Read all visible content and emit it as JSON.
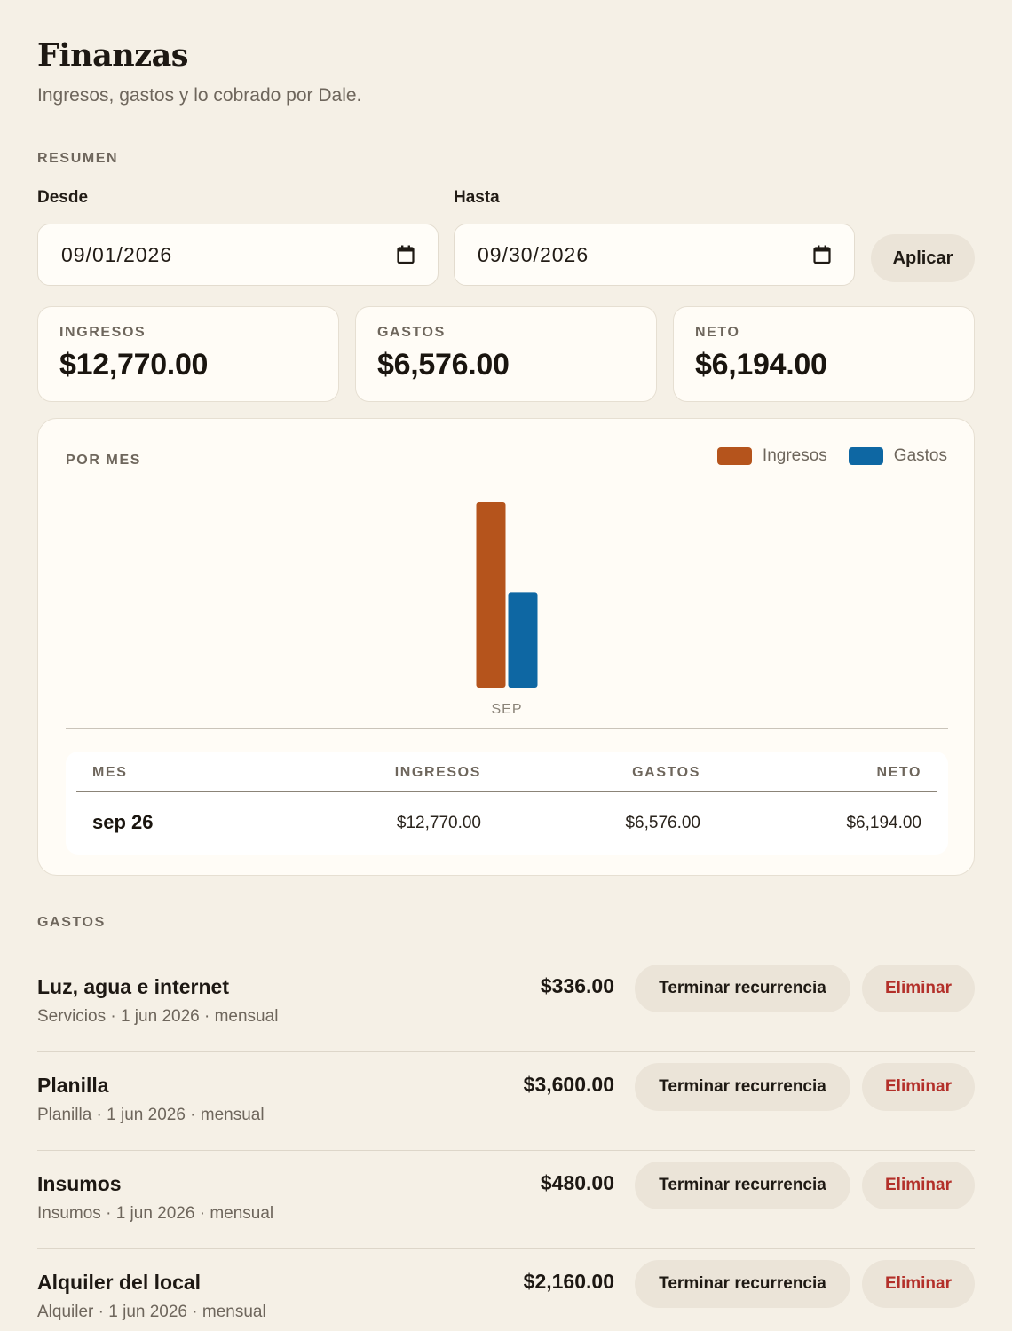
{
  "header": {
    "title": "Finanzas",
    "subtitle": "Ingresos, gastos y lo cobrado por Dale."
  },
  "summary": {
    "section_label": "RESUMEN",
    "from_label": "Desde",
    "from_value": "09/01/2026",
    "to_label": "Hasta",
    "to_value": "09/30/2026",
    "apply_label": "Aplicar",
    "cards": [
      {
        "label": "INGRESOS",
        "value": "$12,770.00"
      },
      {
        "label": "GASTOS",
        "value": "$6,576.00"
      },
      {
        "label": "NETO",
        "value": "$6,194.00"
      }
    ]
  },
  "by_month": {
    "title": "POR MES",
    "legend": [
      {
        "label": "Ingresos",
        "color": "#b5541c"
      },
      {
        "label": "Gastos",
        "color": "#0e67a3"
      }
    ],
    "table": {
      "headers": {
        "month": "MES",
        "income": "INGRESOS",
        "expenses": "GASTOS",
        "net": "NETO"
      },
      "rows": [
        {
          "month": "sep 26",
          "income": "$12,770.00",
          "expenses": "$6,576.00",
          "net": "$6,194.00"
        }
      ]
    }
  },
  "chart_data": {
    "type": "bar",
    "categories": [
      "SEP"
    ],
    "series": [
      {
        "name": "Ingresos",
        "values": [
          12770
        ],
        "color": "#b5541c"
      },
      {
        "name": "Gastos",
        "values": [
          6576
        ],
        "color": "#0e67a3"
      }
    ],
    "ylim": [
      0,
      12770
    ],
    "grid": false,
    "legend": "top-right"
  },
  "expenses": {
    "section_label": "GASTOS",
    "terminate_label": "Terminar recurrencia",
    "delete_label": "Eliminar",
    "items": [
      {
        "name": "Luz, agua e internet",
        "meta": "Servicios · 1 jun 2026 · mensual",
        "amount": "$336.00"
      },
      {
        "name": "Planilla",
        "meta": "Planilla · 1 jun 2026 · mensual",
        "amount": "$3,600.00"
      },
      {
        "name": "Insumos",
        "meta": "Insumos · 1 jun 2026 · mensual",
        "amount": "$480.00"
      },
      {
        "name": "Alquiler del local",
        "meta": "Alquiler · 1 jun 2026 · mensual",
        "amount": "$2,160.00"
      }
    ]
  }
}
